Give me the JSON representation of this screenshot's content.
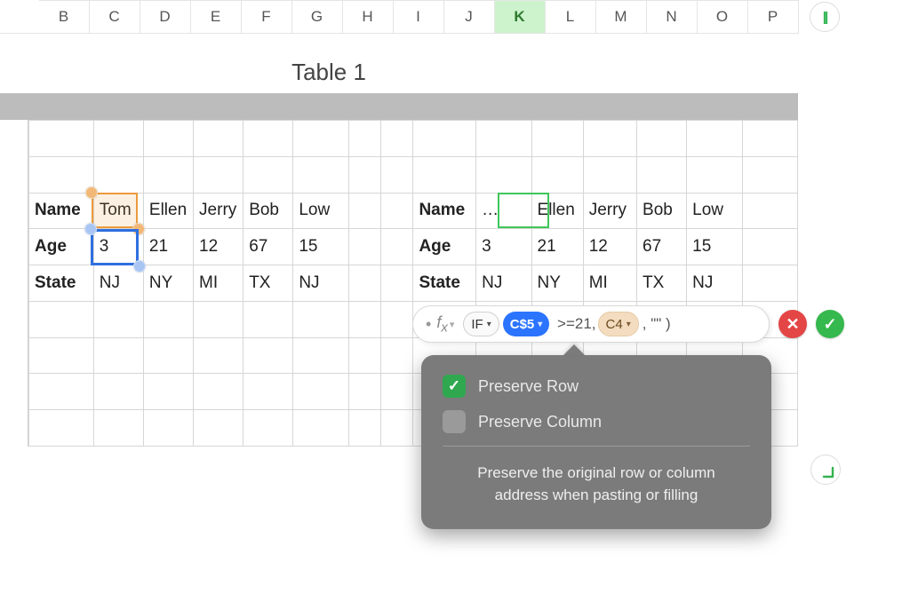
{
  "columns": [
    "B",
    "C",
    "D",
    "E",
    "F",
    "G",
    "H",
    "I",
    "J",
    "K",
    "L",
    "M",
    "N",
    "O",
    "P"
  ],
  "active_column": "K",
  "title": "Table 1",
  "left_table": {
    "headers": [
      "Name",
      "Age",
      "State"
    ],
    "cols": [
      {
        "name": "Tom",
        "age": "3",
        "state": "NJ"
      },
      {
        "name": "Ellen",
        "age": "21",
        "state": "NY"
      },
      {
        "name": "Jerry",
        "age": "12",
        "state": "MI"
      },
      {
        "name": "Bob",
        "age": "67",
        "state": "TX"
      },
      {
        "name": "Low",
        "age": "15",
        "state": "NJ"
      }
    ]
  },
  "right_table": {
    "headers": [
      "Name",
      "Age",
      "State"
    ],
    "cols": [
      {
        "name": "…",
        "age": "3",
        "state": "NJ"
      },
      {
        "name": "Ellen",
        "age": "21",
        "state": "NY"
      },
      {
        "name": "Jerry",
        "age": "12",
        "state": "MI"
      },
      {
        "name": "Bob",
        "age": "67",
        "state": "TX"
      },
      {
        "name": "Low",
        "age": "15",
        "state": "NJ"
      }
    ]
  },
  "formula": {
    "fx_label": "f",
    "fx_sub": "x",
    "if_label": "IF",
    "ref1": "C$5",
    "cmp": ">=21",
    "sep1": ",",
    "ref2": "C4",
    "sep2": ",",
    "tail": "\"\""
  },
  "popover": {
    "preserve_row": {
      "label": "Preserve Row",
      "checked": true
    },
    "preserve_col": {
      "label": "Preserve Column",
      "checked": false
    },
    "hint_line1": "Preserve the original row or column",
    "hint_line2": "address when pasting or filling"
  },
  "buttons": {
    "cancel": "✕",
    "accept": "✓"
  },
  "endcap_glyph": "||"
}
